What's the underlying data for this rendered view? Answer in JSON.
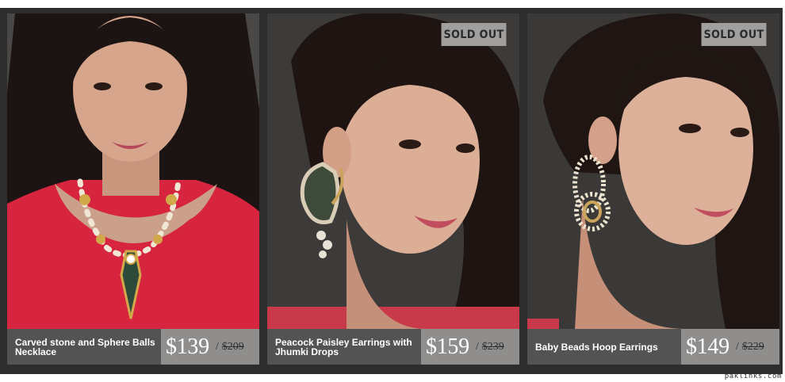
{
  "products": [
    {
      "name": "Carved stone and Sphere Balls Necklace",
      "price": "$139",
      "old_price": "$209",
      "sold_out": false,
      "jewelry_type": "necklace-icon"
    },
    {
      "name": "Peacock Paisley Earrings with Jhumki Drops",
      "price": "$159",
      "old_price": "$239",
      "sold_out": true,
      "badge_label": "SOLD OUT",
      "jewelry_type": "earring-icon"
    },
    {
      "name": "Baby Beads Hoop Earrings",
      "price": "$149",
      "old_price": "$229",
      "sold_out": true,
      "badge_label": "SOLD OUT",
      "jewelry_type": "earring-icon"
    }
  ],
  "separator": "/",
  "watermark": "paklinks.com",
  "colors": {
    "frame": "#2d2d2d",
    "name_bar": "#535353",
    "price_box": "#8f8e8d",
    "badge": "#a19f9d",
    "dress_red": "#d8253f"
  }
}
